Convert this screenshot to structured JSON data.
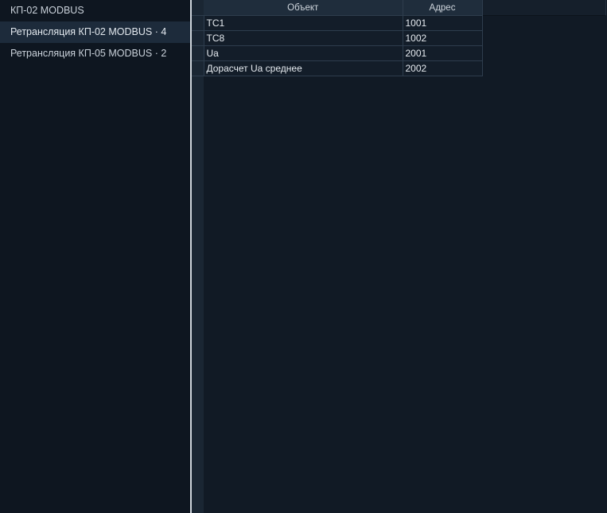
{
  "sidebar": {
    "items": [
      {
        "label": "КП-02 MODBUS",
        "selected": false
      },
      {
        "label": "Ретрансляция КП-02 MODBUS · 4",
        "selected": true
      },
      {
        "label": "Ретрансляция КП-05 MODBUS · 2",
        "selected": false
      }
    ]
  },
  "table": {
    "columns": [
      "Объект",
      "Адрес"
    ],
    "rows": [
      {
        "object": "ТС1",
        "address": "1001"
      },
      {
        "object": "ТС8",
        "address": "1002"
      },
      {
        "object": "Ua",
        "address": "2001"
      },
      {
        "object": "Дорасчет Ua среднее",
        "address": "2002"
      }
    ]
  },
  "colors": {
    "background": "#0f1722",
    "selected_item": "#1d2b3b",
    "splitter": "#cfd6dc",
    "header_cell": "#1f2d3c"
  }
}
